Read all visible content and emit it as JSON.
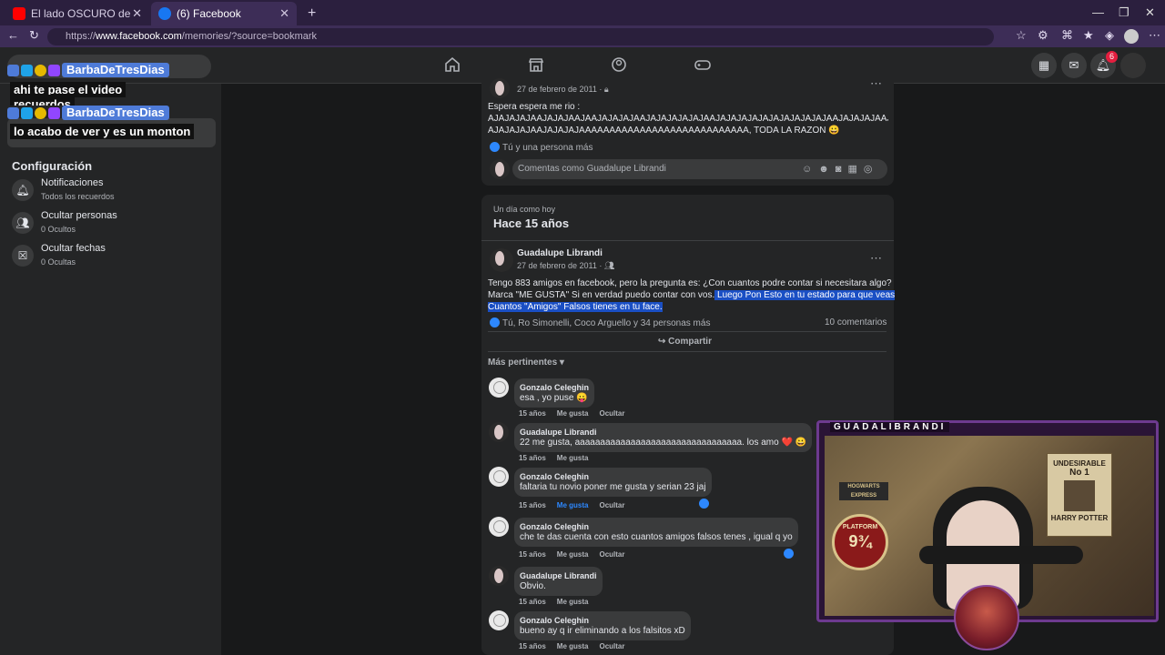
{
  "browser": {
    "tabs": [
      {
        "label": "El lado OSCURO de ARGENTINA #",
        "favicon_color": "#ff0000"
      },
      {
        "label": "(6) Facebook",
        "favicon_color": "#1877f2"
      }
    ],
    "url_prefix": "https://",
    "url_host": "www.facebook.com",
    "url_path": "/memories/?source=bookmark"
  },
  "fb_header": {
    "notification_count": "6",
    "nav_icons": [
      "home-icon",
      "marketplace-icon",
      "groups-icon",
      "gaming-icon"
    ]
  },
  "chat_overlay": [
    {
      "user": "BarbaDeTresDias",
      "message": "ahi te pase el video"
    },
    {
      "user": "BarbaDeTresDias",
      "message": "lo acabo de ver y es un monton"
    }
  ],
  "chat_overlay_partial": "recuerdos",
  "sidebar": {
    "section_title": "Configuración",
    "items": [
      {
        "label": "Notificaciones",
        "sub": "Todos los recuerdos",
        "icon": "bell-icon"
      },
      {
        "label": "Ocultar personas",
        "sub": "0 Ocultos",
        "icon": "people-icon"
      },
      {
        "label": "Ocultar fechas",
        "sub": "0 Ocultas",
        "icon": "calendar-x-icon"
      }
    ]
  },
  "post1": {
    "date": "27 de febrero de 2011 ·",
    "text_line1": "Espera espera me rio :",
    "text_line2": "AJAJAJAJAAJAJAJAAJAAJAJAJAJAAJAJAJAJAJAJAAJAJAJAJAJAJAJAJAJAJAJAAJAJAJAJAAJAJAJ",
    "text_line3": "AJAJAJAJAAJAJAJAJAAAAAAAAAAAAAAAAAAAAAAAAAAAA, TODA LA RAZON 😀",
    "likes": "Tú y una persona más",
    "comment_placeholder": "Comentas como Guadalupe Librandi"
  },
  "memory": {
    "kicker": "Un día como hoy",
    "title": "Hace 15 años"
  },
  "post2": {
    "author": "Guadalupe Librandi",
    "date": "27 de febrero de 2011 ·",
    "text_a": "Tengo 883 amigos en facebook, pero la pregunta es: ¿Con cuantos podre contar si necesitara algo?",
    "text_b": "Marca \"ME GUSTA\" Si en verdad puedo contar con vos.",
    "text_b_hl": " Luego Pon Esto en tu estado para que veas",
    "text_c_hl": "Cuantos \"Amigos\" Falsos tienes en tu face.",
    "likes": "Tú, Ro Simonelli, Coco Arguello y 34 personas más",
    "comments_count": "10 comentarios",
    "share": "Compartir",
    "sort_label": "Más pertinentes"
  },
  "comments": [
    {
      "name": "Gonzalo Celeghin",
      "text": "esa , yo puse 😛",
      "age": "15 años",
      "like": "Me gusta",
      "hide": "Ocultar",
      "avatar": "light"
    },
    {
      "name": "Guadalupe Librandi",
      "text": "22 me gusta, aaaaaaaaaaaaaaaaaaaaaaaaaaaaaaaaa. los amo ❤️ 😀",
      "age": "15 años",
      "like": "Me gusta",
      "hide": "",
      "avatar": "dark"
    },
    {
      "name": "Gonzalo Celeghin",
      "text": "faltaria tu novio poner me gusta y serian 23 jaj",
      "age": "15 años",
      "like": "Me gusta",
      "hide": "Ocultar",
      "avatar": "light",
      "liked": true
    },
    {
      "name": "Gonzalo Celeghin",
      "text": "che te das cuenta con esto cuantos amigos falsos tenes , igual q yo",
      "age": "15 años",
      "like": "Me gusta",
      "hide": "Ocultar",
      "avatar": "light"
    },
    {
      "name": "Guadalupe Librandi",
      "text": "Obvio.",
      "age": "15 años",
      "like": "Me gusta",
      "hide": "",
      "avatar": "dark"
    },
    {
      "name": "Gonzalo Celeghin",
      "text": "bueno ay q ir eliminando a los falsitos xD",
      "age": "15 años",
      "like": "Me gusta",
      "hide": "Ocultar",
      "avatar": "light"
    }
  ],
  "webcam": {
    "label": "GUADALIBRANDI",
    "poster_title": "UNDESIRABLE",
    "poster_no": "No 1",
    "poster_name": "HARRY POTTER",
    "platform_top": "PLATFORM",
    "platform_num": "9¾",
    "hogwarts": "HOGWARTS EXPRESS"
  },
  "colors": {
    "accent": "#2d88ff",
    "highlight": "#1a4fc4",
    "chrome": "#3d2d57"
  }
}
